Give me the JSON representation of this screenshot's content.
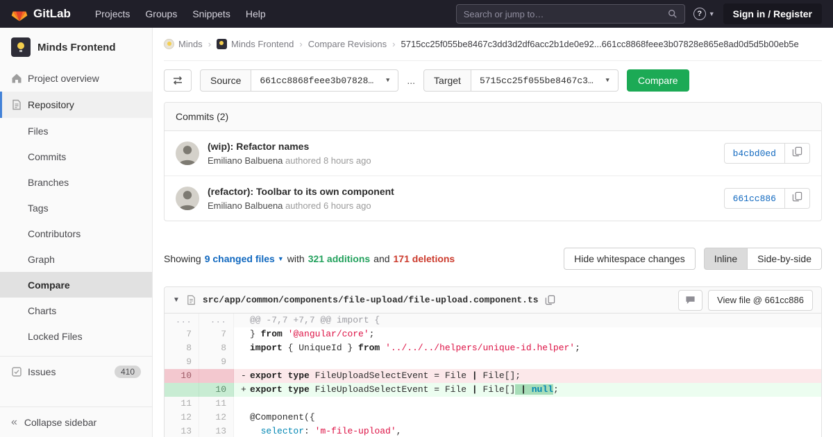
{
  "navbar": {
    "logo_text": "GitLab",
    "items": [
      "Projects",
      "Groups",
      "Snippets",
      "Help"
    ],
    "search_placeholder": "Search or jump to…",
    "signin_label": "Sign in / Register"
  },
  "sidebar": {
    "project_name": "Minds Frontend",
    "overview_label": "Project overview",
    "repository": {
      "label": "Repository",
      "subitems": [
        "Files",
        "Commits",
        "Branches",
        "Tags",
        "Contributors",
        "Graph",
        "Compare",
        "Charts",
        "Locked Files"
      ],
      "active_subitem": "Compare"
    },
    "issues_label": "Issues",
    "issues_badge": "410",
    "collapse_label": "Collapse sidebar"
  },
  "breadcrumb": {
    "items": [
      {
        "label": "Minds",
        "avatar": "group"
      },
      {
        "label": "Minds Frontend",
        "avatar": "project"
      },
      {
        "label": "Compare Revisions",
        "avatar": ""
      }
    ],
    "current": "5715cc25f055be8467c3dd3d2df6acc2b1de0e92...661cc8868feee3b07828e865e8ad0d5d5b00eb5e"
  },
  "compare_form": {
    "source_label": "Source",
    "source_value": "661cc8868feee3b07828…",
    "separator": "...",
    "target_label": "Target",
    "target_value": "5715cc25f055be8467c3…",
    "compare_button": "Compare"
  },
  "commits": {
    "header": "Commits (2)",
    "list": [
      {
        "title": "(wip): Refactor names",
        "author": "Emiliano Balbuena",
        "meta": "authored 8 hours ago",
        "sha": "b4cbd0ed"
      },
      {
        "title": "(refactor): Toolbar to its own component",
        "author": "Emiliano Balbuena",
        "meta": "authored 6 hours ago",
        "sha": "661cc886"
      }
    ]
  },
  "diff_summary": {
    "showing": "Showing",
    "files": "9 changed files",
    "with": "with",
    "additions": "321 additions",
    "and": "and",
    "deletions": "171 deletions",
    "hide_whitespace": "Hide whitespace changes",
    "inline": "Inline",
    "side_by_side": "Side-by-side"
  },
  "diff_file": {
    "path": "src/app/common/components/file-upload/file-upload.component.ts",
    "view_file": "View file @ 661cc886",
    "rows": [
      {
        "o": "...",
        "n": "...",
        "t": "hunk",
        "s": [
          [
            "@@ -7,7 +7,7 @@ import {",
            ""
          ]
        ]
      },
      {
        "o": "7",
        "n": "7",
        "t": "ctx",
        "s": [
          [
            "} ",
            ""
          ],
          [
            "from",
            "k"
          ],
          [
            " ",
            ""
          ],
          [
            "'@angular/core'",
            "s"
          ],
          [
            ";",
            ""
          ]
        ]
      },
      {
        "o": "8",
        "n": "8",
        "t": "ctx",
        "s": [
          [
            "import",
            "k"
          ],
          [
            " { UniqueId } ",
            ""
          ],
          [
            "from",
            "k"
          ],
          [
            " ",
            ""
          ],
          [
            "'../../../helpers/unique-id.helper'",
            "s"
          ],
          [
            ";",
            ""
          ]
        ]
      },
      {
        "o": "9",
        "n": "9",
        "t": "ctx",
        "s": []
      },
      {
        "o": "10",
        "n": "",
        "t": "del",
        "s": [
          [
            "export",
            "k"
          ],
          [
            " ",
            ""
          ],
          [
            "type",
            "k"
          ],
          [
            " FileUploadSelectEvent = File ",
            ""
          ],
          [
            "|",
            "k"
          ],
          [
            " File[];",
            ""
          ]
        ]
      },
      {
        "o": "",
        "n": "10",
        "t": "add",
        "s": [
          [
            "export",
            "k"
          ],
          [
            " ",
            ""
          ],
          [
            "type",
            "k"
          ],
          [
            " FileUploadSelectEvent = File ",
            ""
          ],
          [
            "|",
            "k"
          ],
          [
            " File[]",
            ""
          ],
          [
            " ",
            "hl"
          ],
          [
            "|",
            "hl k"
          ],
          [
            " ",
            "hl"
          ],
          [
            "null",
            "hl t b"
          ],
          [
            ";",
            ""
          ]
        ]
      },
      {
        "o": "11",
        "n": "11",
        "t": "ctx",
        "s": []
      },
      {
        "o": "12",
        "n": "12",
        "t": "ctx",
        "s": [
          [
            "@Component({",
            ""
          ]
        ]
      },
      {
        "o": "13",
        "n": "13",
        "t": "ctx",
        "s": [
          [
            "  ",
            ""
          ],
          [
            "selector",
            "t"
          ],
          [
            ": ",
            ""
          ],
          [
            "'m-file-upload'",
            "s"
          ],
          [
            ",",
            ""
          ]
        ]
      }
    ]
  },
  "colors": {
    "navbar_bg": "#201f29",
    "accent_green": "#1caa55",
    "link_blue": "#1068bf",
    "addition_green": "#23a15d",
    "deletion_red": "#cc3b2d"
  }
}
